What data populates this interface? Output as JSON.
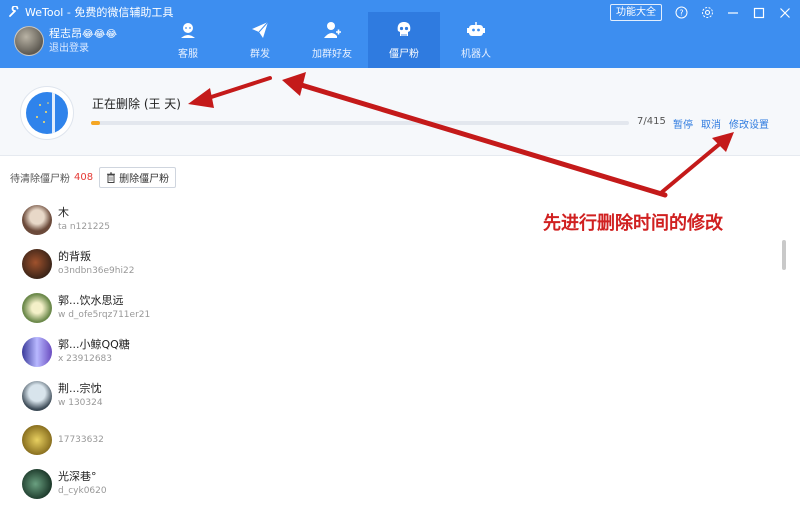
{
  "app": {
    "title": "WeTool - 免费的微信辅助工具",
    "func_button": "功能大全"
  },
  "user": {
    "name": "程志昂",
    "emoji": "😂😂😂",
    "logout": "退出登录"
  },
  "nav": [
    {
      "label": "客服",
      "icon": "customer-service-icon"
    },
    {
      "label": "群发",
      "icon": "paper-plane-icon"
    },
    {
      "label": "加群好友",
      "icon": "add-friend-icon"
    },
    {
      "label": "僵尸粉",
      "icon": "skull-icon"
    },
    {
      "label": "机器人",
      "icon": "robot-icon"
    }
  ],
  "progress": {
    "status": "正在删除 (王   天)",
    "count": "7/415",
    "fraction": 0.0169,
    "pause": "暂停",
    "cancel": "取消",
    "settings": "修改设置"
  },
  "pending": {
    "label": "待清除僵尸粉",
    "count": "408",
    "delete_button": "删除僵尸粉"
  },
  "contacts": [
    {
      "name": "木",
      "id": "ta    n121225"
    },
    {
      "name": "的背叛",
      "id": "o3ndbn36e9hi22"
    },
    {
      "name": "郭...饮水思远",
      "id": "w    d_ofe5rqz711er21"
    },
    {
      "name": "郭...小鲸QQ糖",
      "id": "x    23912683"
    },
    {
      "name": "荆...宗忱",
      "id": "w    130324"
    },
    {
      "name": "",
      "id": "17733632"
    },
    {
      "name": "光深巷°",
      "id": "d_cyk0620"
    }
  ],
  "annotation": "先进行删除时间的修改",
  "colors": {
    "header": "#3d8ef0",
    "nav_active": "#2f7be0",
    "progress": "#f5a623",
    "annotation": "#d02020",
    "count_red": "#e53935"
  }
}
